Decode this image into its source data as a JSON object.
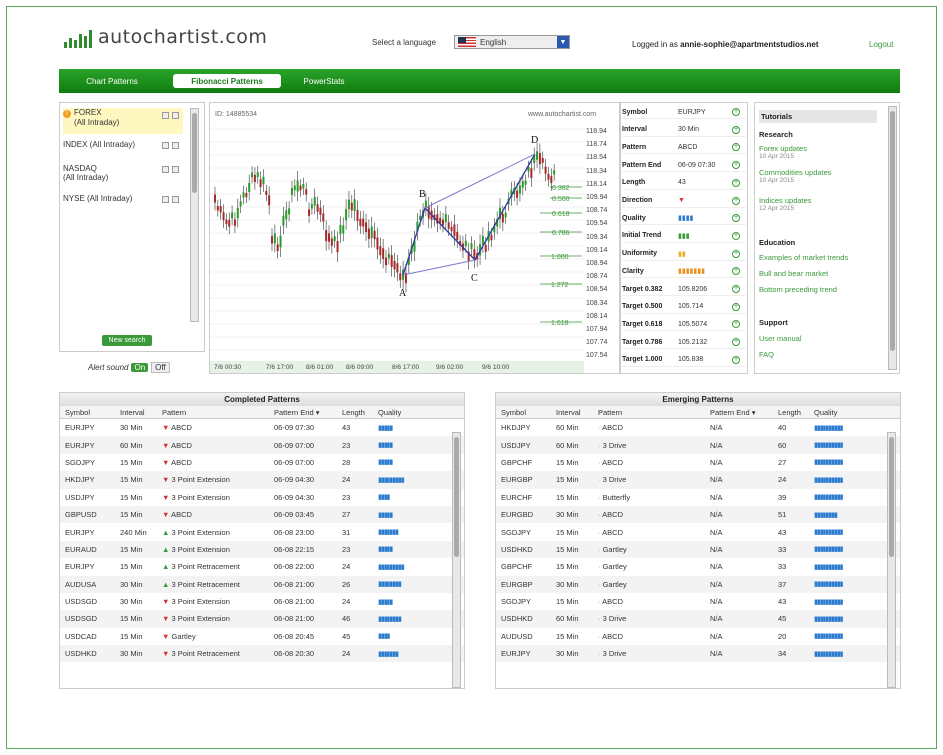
{
  "header": {
    "logo_text": "autochartist.com",
    "lang_label": "Select a language",
    "language": "English",
    "login_prefix": "Logged in as",
    "login_user": "annie-sophie@apartmentstudios.net",
    "logout": "Logout"
  },
  "nav": {
    "tabs": [
      "Chart Patterns",
      "Fibonacci Patterns",
      "PowerStats"
    ],
    "active": "Fibonacci Patterns"
  },
  "markets": {
    "items": [
      {
        "label": "FOREX",
        "sub": "(All Intraday)"
      },
      {
        "label": "INDEX (All Intraday)",
        "sub": ""
      },
      {
        "label": "NASDAQ",
        "sub": "(All Intraday)"
      },
      {
        "label": "NYSE (All Intraday)",
        "sub": ""
      }
    ],
    "new_search": "New search",
    "alert_label": "Alert sound",
    "on": "On",
    "off": "Off"
  },
  "chart": {
    "id_label": "ID: 14885534",
    "site": "www.autochartist.com",
    "point_labels": [
      "D",
      "B",
      "A",
      "C"
    ],
    "y_ticks": [
      "118.94",
      "118.74",
      "118.54",
      "118.34",
      "118.14",
      "109.94",
      "108.74",
      "109.54",
      "109.34",
      "109.14",
      "108.94",
      "108.74",
      "108.54",
      "108.34",
      "108.14",
      "107.94",
      "107.74",
      "107.54"
    ],
    "x_ticks": [
      "7/6 00:30",
      "7/6 17:00",
      "8/6 01:00",
      "8/6 09:00",
      "8/6 17:00",
      "9/6 02:00",
      "9/6 10:00"
    ],
    "fib_levels": [
      "0.382",
      "0.500",
      "0.618",
      "0.786",
      "1.000",
      "1.272",
      "1.618"
    ]
  },
  "details": {
    "rows": [
      {
        "k": "Symbol",
        "v": "EURJPY"
      },
      {
        "k": "Interval",
        "v": "30 Min"
      },
      {
        "k": "Pattern",
        "v": "ABCD"
      },
      {
        "k": "Pattern End",
        "v": "06-09 07:30"
      },
      {
        "k": "Length",
        "v": "43"
      },
      {
        "k": "Direction",
        "v": "▼"
      },
      {
        "k": "Quality",
        "v": "▮▮▮▮"
      },
      {
        "k": "Initial Trend",
        "v": "▮▮▮"
      },
      {
        "k": "Uniformity",
        "v": "▮▮"
      },
      {
        "k": "Clarity",
        "v": "▮▮▮▮▮▮▮"
      },
      {
        "k": "Target 0.382",
        "v": "105.8206"
      },
      {
        "k": "Target 0.500",
        "v": "105.714"
      },
      {
        "k": "Target 0.618",
        "v": "105.5074"
      },
      {
        "k": "Target 0.786",
        "v": "105.2132"
      },
      {
        "k": "Target 1.000",
        "v": "105.838"
      }
    ]
  },
  "tutorials": {
    "title": "Tutorials",
    "research": "Research",
    "links": [
      {
        "t": "Forex updates",
        "d": "10 Apr 2015"
      },
      {
        "t": "Commodities updates",
        "d": "10 Apr 2015"
      },
      {
        "t": "Indices updates",
        "d": "12 Apr 2015"
      }
    ],
    "education": "Education",
    "edu_links": [
      "Examples of market trends",
      "Bull and bear market",
      "Bottom preceding trend"
    ],
    "support": "Support",
    "support_links": [
      "User manual",
      "FAQ"
    ]
  },
  "completed": {
    "title": "Completed Patterns",
    "headers": [
      "Symbol",
      "Interval",
      "Pattern",
      "Pattern End ▾",
      "Length",
      "Quality"
    ],
    "rows": [
      [
        "EURJPY",
        "30 Min",
        "down",
        "ABCD",
        "06-09 07:30",
        "43",
        "▮▮▮▮▮"
      ],
      [
        "EURJPY",
        "60 Min",
        "down",
        "ABCD",
        "06-09 07:00",
        "23",
        "▮▮▮▮▮"
      ],
      [
        "SGDJPY",
        "15 Min",
        "down",
        "ABCD",
        "06-09 07:00",
        "28",
        "▮▮▮▮▮"
      ],
      [
        "HKDJPY",
        "15 Min",
        "down",
        "3 Point Extension",
        "06-09 04:30",
        "24",
        "▮▮▮▮▮▮▮▮▮"
      ],
      [
        "USDJPY",
        "15 Min",
        "down",
        "3 Point Extension",
        "06-09 04:30",
        "23",
        "▮▮▮▮"
      ],
      [
        "GBPUSD",
        "15 Min",
        "down",
        "ABCD",
        "06-09 03:45",
        "27",
        "▮▮▮▮▮"
      ],
      [
        "EURJPY",
        "240 Min",
        "up",
        "3 Point Extension",
        "06-08 23:00",
        "31",
        "▮▮▮▮▮▮▮"
      ],
      [
        "EURAUD",
        "15 Min",
        "up",
        "3 Point Extension",
        "06-08 22:15",
        "23",
        "▮▮▮▮▮"
      ],
      [
        "EURJPY",
        "15 Min",
        "up",
        "3 Point Retracement",
        "06-08 22:00",
        "24",
        "▮▮▮▮▮▮▮▮▮"
      ],
      [
        "AUDUSA",
        "30 Min",
        "up",
        "3 Point Retracement",
        "06-08 21:00",
        "26",
        "▮▮▮▮▮▮▮▮"
      ],
      [
        "USDSGD",
        "30 Min",
        "down",
        "3 Point Extension",
        "06-08 21:00",
        "24",
        "▮▮▮▮▮"
      ],
      [
        "USDSGD",
        "15 Min",
        "down",
        "3 Point Extension",
        "06-08 21:00",
        "46",
        "▮▮▮▮▮▮▮▮"
      ],
      [
        "USDCAD",
        "15 Min",
        "down",
        "Gartley",
        "06-08 20:45",
        "45",
        "▮▮▮▮"
      ],
      [
        "USDHKD",
        "30 Min",
        "down",
        "3 Point Retracement",
        "06-08 20:30",
        "24",
        "▮▮▮▮▮▮▮"
      ]
    ]
  },
  "emerging": {
    "title": "Emerging Patterns",
    "headers": [
      "Symbol",
      "Interval",
      "Pattern",
      "Pattern End ▾",
      "Length",
      "Quality"
    ],
    "rows": [
      [
        "HKDJPY",
        "60 Min",
        "neu",
        "ABCD",
        "N/A",
        "40",
        "▮▮▮▮▮▮▮▮▮▮"
      ],
      [
        "USDJPY",
        "60 Min",
        "neu",
        "3 Drive",
        "N/A",
        "60",
        "▮▮▮▮▮▮▮▮▮▮"
      ],
      [
        "GBPCHF",
        "15 Min",
        "neu",
        "ABCD",
        "N/A",
        "27",
        "▮▮▮▮▮▮▮▮▮▮"
      ],
      [
        "EURGBP",
        "15 Min",
        "neu",
        "3 Drive",
        "N/A",
        "24",
        "▮▮▮▮▮▮▮▮▮▮"
      ],
      [
        "EURCHF",
        "15 Min",
        "neu",
        "Butterfly",
        "N/A",
        "39",
        "▮▮▮▮▮▮▮▮▮▮"
      ],
      [
        "EURGBD",
        "30 Min",
        "neu",
        "ABCD",
        "N/A",
        "51",
        "▮▮▮▮▮▮▮▮"
      ],
      [
        "SGDJPY",
        "15 Min",
        "neu",
        "ABCD",
        "N/A",
        "43",
        "▮▮▮▮▮▮▮▮▮▮"
      ],
      [
        "USDHKD",
        "15 Min",
        "neu",
        "Gartley",
        "N/A",
        "33",
        "▮▮▮▮▮▮▮▮▮▮"
      ],
      [
        "GBPCHF",
        "15 Min",
        "neu",
        "Gartley",
        "N/A",
        "33",
        "▮▮▮▮▮▮▮▮▮▮"
      ],
      [
        "EURGBP",
        "30 Min",
        "neu",
        "Gartley",
        "N/A",
        "37",
        "▮▮▮▮▮▮▮▮▮▮"
      ],
      [
        "SGDJPY",
        "15 Min",
        "neu",
        "ABCD",
        "N/A",
        "43",
        "▮▮▮▮▮▮▮▮▮▮"
      ],
      [
        "USDHKD",
        "60 Min",
        "neu",
        "3 Drive",
        "N/A",
        "45",
        "▮▮▮▮▮▮▮▮▮▮"
      ],
      [
        "AUDUSD",
        "15 Min",
        "neu",
        "ABCD",
        "N/A",
        "20",
        "▮▮▮▮▮▮▮▮▮▮"
      ],
      [
        "EURJPY",
        "30 Min",
        "neu",
        "3 Drive",
        "N/A",
        "34",
        "▮▮▮▮▮▮▮▮▮▮"
      ]
    ]
  }
}
